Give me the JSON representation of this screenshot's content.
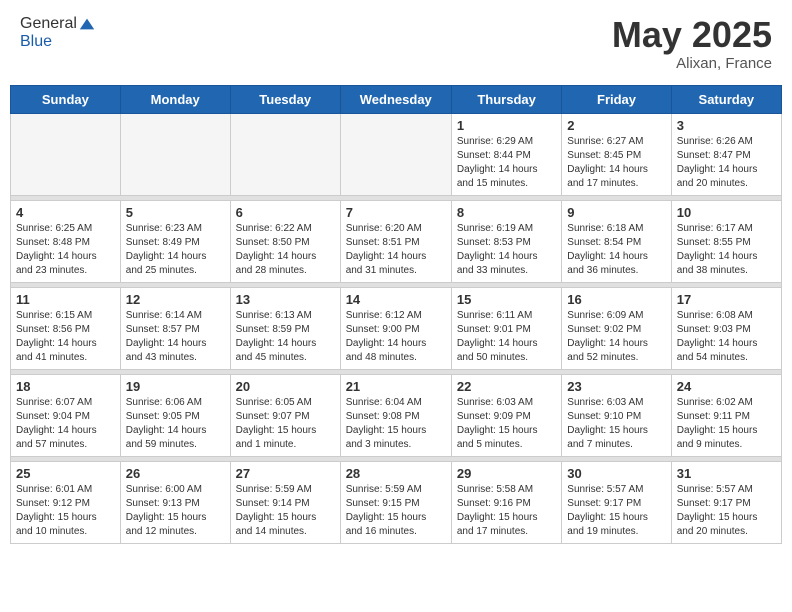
{
  "header": {
    "logo_general": "General",
    "logo_blue": "Blue",
    "month_year": "May 2025",
    "location": "Alixan, France"
  },
  "weekdays": [
    "Sunday",
    "Monday",
    "Tuesday",
    "Wednesday",
    "Thursday",
    "Friday",
    "Saturday"
  ],
  "weeks": [
    [
      {
        "day": "",
        "info": ""
      },
      {
        "day": "",
        "info": ""
      },
      {
        "day": "",
        "info": ""
      },
      {
        "day": "",
        "info": ""
      },
      {
        "day": "1",
        "info": "Sunrise: 6:29 AM\nSunset: 8:44 PM\nDaylight: 14 hours\nand 15 minutes."
      },
      {
        "day": "2",
        "info": "Sunrise: 6:27 AM\nSunset: 8:45 PM\nDaylight: 14 hours\nand 17 minutes."
      },
      {
        "day": "3",
        "info": "Sunrise: 6:26 AM\nSunset: 8:47 PM\nDaylight: 14 hours\nand 20 minutes."
      }
    ],
    [
      {
        "day": "4",
        "info": "Sunrise: 6:25 AM\nSunset: 8:48 PM\nDaylight: 14 hours\nand 23 minutes."
      },
      {
        "day": "5",
        "info": "Sunrise: 6:23 AM\nSunset: 8:49 PM\nDaylight: 14 hours\nand 25 minutes."
      },
      {
        "day": "6",
        "info": "Sunrise: 6:22 AM\nSunset: 8:50 PM\nDaylight: 14 hours\nand 28 minutes."
      },
      {
        "day": "7",
        "info": "Sunrise: 6:20 AM\nSunset: 8:51 PM\nDaylight: 14 hours\nand 31 minutes."
      },
      {
        "day": "8",
        "info": "Sunrise: 6:19 AM\nSunset: 8:53 PM\nDaylight: 14 hours\nand 33 minutes."
      },
      {
        "day": "9",
        "info": "Sunrise: 6:18 AM\nSunset: 8:54 PM\nDaylight: 14 hours\nand 36 minutes."
      },
      {
        "day": "10",
        "info": "Sunrise: 6:17 AM\nSunset: 8:55 PM\nDaylight: 14 hours\nand 38 minutes."
      }
    ],
    [
      {
        "day": "11",
        "info": "Sunrise: 6:15 AM\nSunset: 8:56 PM\nDaylight: 14 hours\nand 41 minutes."
      },
      {
        "day": "12",
        "info": "Sunrise: 6:14 AM\nSunset: 8:57 PM\nDaylight: 14 hours\nand 43 minutes."
      },
      {
        "day": "13",
        "info": "Sunrise: 6:13 AM\nSunset: 8:59 PM\nDaylight: 14 hours\nand 45 minutes."
      },
      {
        "day": "14",
        "info": "Sunrise: 6:12 AM\nSunset: 9:00 PM\nDaylight: 14 hours\nand 48 minutes."
      },
      {
        "day": "15",
        "info": "Sunrise: 6:11 AM\nSunset: 9:01 PM\nDaylight: 14 hours\nand 50 minutes."
      },
      {
        "day": "16",
        "info": "Sunrise: 6:09 AM\nSunset: 9:02 PM\nDaylight: 14 hours\nand 52 minutes."
      },
      {
        "day": "17",
        "info": "Sunrise: 6:08 AM\nSunset: 9:03 PM\nDaylight: 14 hours\nand 54 minutes."
      }
    ],
    [
      {
        "day": "18",
        "info": "Sunrise: 6:07 AM\nSunset: 9:04 PM\nDaylight: 14 hours\nand 57 minutes."
      },
      {
        "day": "19",
        "info": "Sunrise: 6:06 AM\nSunset: 9:05 PM\nDaylight: 14 hours\nand 59 minutes."
      },
      {
        "day": "20",
        "info": "Sunrise: 6:05 AM\nSunset: 9:07 PM\nDaylight: 15 hours\nand 1 minute."
      },
      {
        "day": "21",
        "info": "Sunrise: 6:04 AM\nSunset: 9:08 PM\nDaylight: 15 hours\nand 3 minutes."
      },
      {
        "day": "22",
        "info": "Sunrise: 6:03 AM\nSunset: 9:09 PM\nDaylight: 15 hours\nand 5 minutes."
      },
      {
        "day": "23",
        "info": "Sunrise: 6:03 AM\nSunset: 9:10 PM\nDaylight: 15 hours\nand 7 minutes."
      },
      {
        "day": "24",
        "info": "Sunrise: 6:02 AM\nSunset: 9:11 PM\nDaylight: 15 hours\nand 9 minutes."
      }
    ],
    [
      {
        "day": "25",
        "info": "Sunrise: 6:01 AM\nSunset: 9:12 PM\nDaylight: 15 hours\nand 10 minutes."
      },
      {
        "day": "26",
        "info": "Sunrise: 6:00 AM\nSunset: 9:13 PM\nDaylight: 15 hours\nand 12 minutes."
      },
      {
        "day": "27",
        "info": "Sunrise: 5:59 AM\nSunset: 9:14 PM\nDaylight: 15 hours\nand 14 minutes."
      },
      {
        "day": "28",
        "info": "Sunrise: 5:59 AM\nSunset: 9:15 PM\nDaylight: 15 hours\nand 16 minutes."
      },
      {
        "day": "29",
        "info": "Sunrise: 5:58 AM\nSunset: 9:16 PM\nDaylight: 15 hours\nand 17 minutes."
      },
      {
        "day": "30",
        "info": "Sunrise: 5:57 AM\nSunset: 9:17 PM\nDaylight: 15 hours\nand 19 minutes."
      },
      {
        "day": "31",
        "info": "Sunrise: 5:57 AM\nSunset: 9:17 PM\nDaylight: 15 hours\nand 20 minutes."
      }
    ]
  ]
}
